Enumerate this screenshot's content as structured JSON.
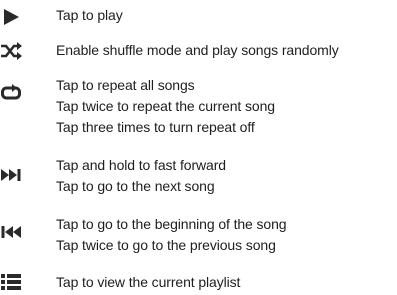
{
  "items": [
    {
      "icon": "play-icon",
      "lines": [
        "Tap to play"
      ]
    },
    {
      "icon": "shuffle-icon",
      "lines": [
        "Enable shuffle mode and play songs randomly"
      ]
    },
    {
      "icon": "repeat-icon",
      "lines": [
        "Tap to repeat all songs",
        "Tap twice to repeat the current song",
        "Tap three times to turn repeat off"
      ]
    },
    {
      "icon": "fast-forward-icon",
      "lines": [
        "Tap and hold to fast forward",
        "Tap to go to the next song"
      ]
    },
    {
      "icon": "previous-icon",
      "lines": [
        "Tap to go to the beginning of the song",
        "Tap twice to go to the previous song"
      ]
    },
    {
      "icon": "playlist-icon",
      "lines": [
        "Tap to view the current playlist"
      ]
    }
  ]
}
